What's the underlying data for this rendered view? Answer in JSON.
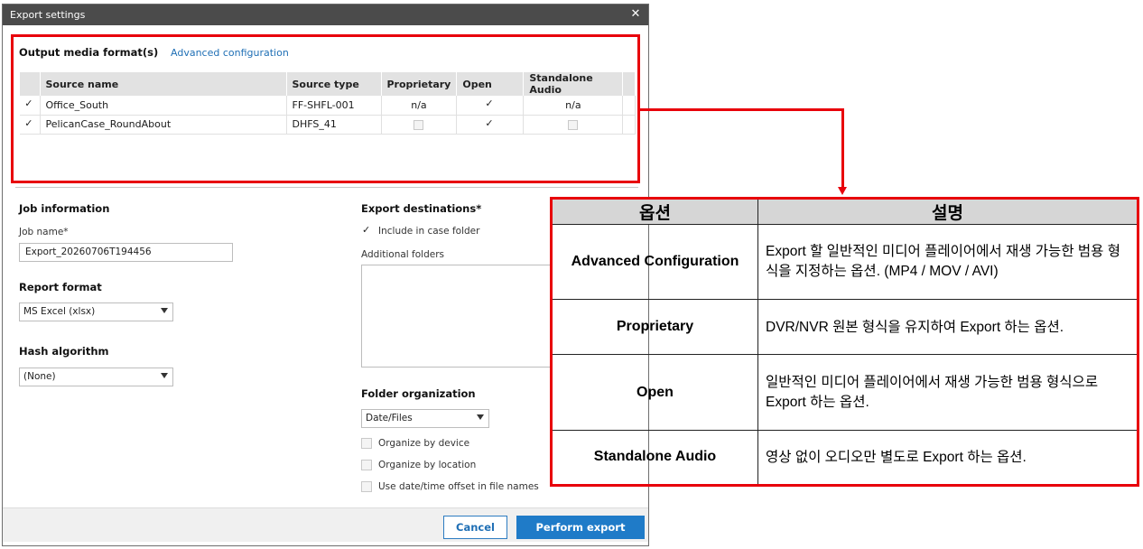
{
  "window": {
    "title": "Export settings",
    "close_glyph": "✕"
  },
  "output_media": {
    "title": "Output media format(s)",
    "advanced_link": "Advanced configuration",
    "columns": [
      "Source name",
      "Source type",
      "Proprietary",
      "Open",
      "Standalone Audio"
    ],
    "rows": [
      {
        "name": "Office_South",
        "type": "FF-SHFL-001",
        "proprietary": "n/a",
        "open": true,
        "audio": "n/a"
      },
      {
        "name": "PelicanCase_RoundAbout",
        "type": "DHFS_41",
        "proprietary": "",
        "open": true,
        "audio": ""
      }
    ]
  },
  "job": {
    "title": "Job information",
    "name_label": "Job name*",
    "name_value": "Export_20260706T194456"
  },
  "report": {
    "title": "Report format",
    "value": "MS Excel (xlsx)"
  },
  "hash": {
    "title": "Hash algorithm",
    "value": "(None)"
  },
  "destinations": {
    "title": "Export destinations*",
    "include_case": "Include in case folder",
    "additional_label": "Additional folders"
  },
  "folder_org": {
    "title": "Folder organization",
    "value": "Date/Files",
    "by_device": "Organize by device",
    "by_location": "Organize by location",
    "date_offset": "Use date/time offset in file names"
  },
  "footer": {
    "cancel": "Cancel",
    "perform": "Perform export"
  },
  "annotation": {
    "header_option": "옵션",
    "header_desc": "설명",
    "rows": [
      {
        "option": "Advanced Configuration",
        "desc": "Export 할 일반적인 미디어 플레이어에서 재생 가능한 범용 형식을 지정하는 옵션. (MP4 / MOV / AVI)"
      },
      {
        "option": "Proprietary",
        "desc": "DVR/NVR 원본 형식을 유지하여 Export 하는 옵션."
      },
      {
        "option": "Open",
        "desc": "일반적인 미디어 플레이어에서 재생 가능한 범용 형식으로 Export 하는 옵션."
      },
      {
        "option": "Standalone Audio",
        "desc": "영상 없이 오디오만 별도로 Export 하는 옵션."
      }
    ]
  },
  "colors": {
    "accent": "#1f7bc8",
    "highlight": "#e8000b",
    "titlebar": "#4b4b4b"
  }
}
